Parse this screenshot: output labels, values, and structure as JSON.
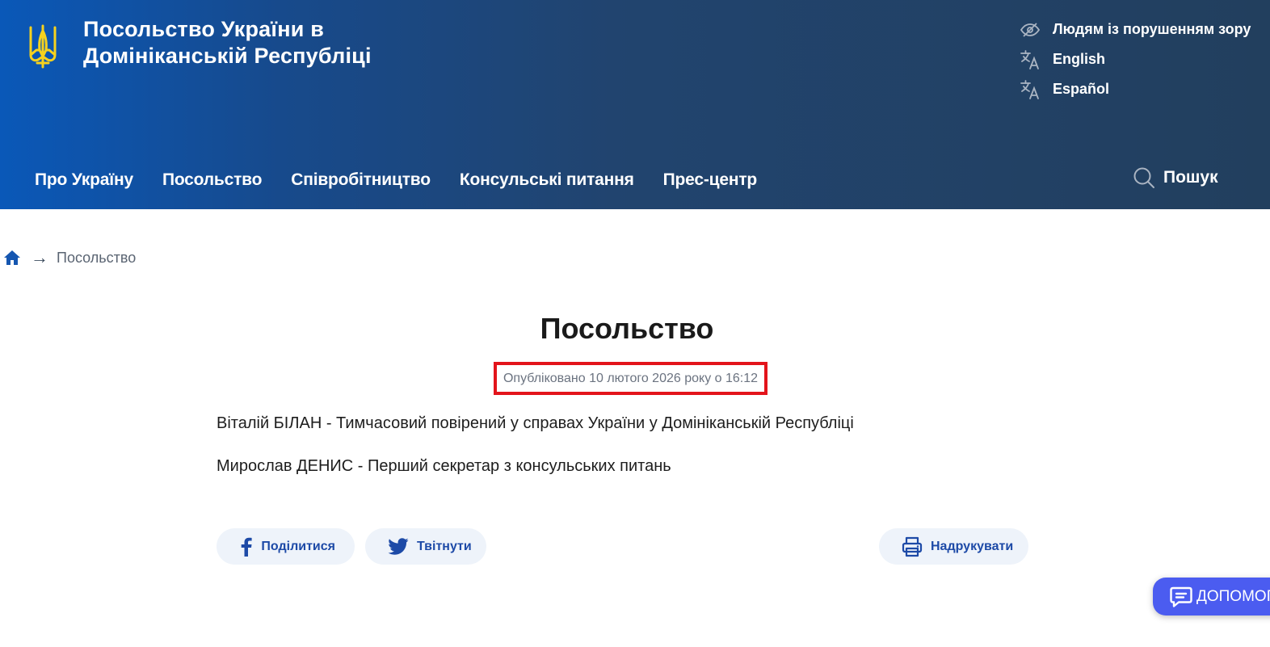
{
  "header": {
    "title_line1": "Посольство України в",
    "title_line2": "Домініканській Республіці",
    "colors": {
      "gradient_start": "#0a58b8",
      "gradient_end": "#223f5e",
      "emblem": "#f6d21e"
    },
    "utility_links": [
      {
        "label": "Людям із порушенням зору",
        "icon": "low-vision-icon"
      },
      {
        "label": "English",
        "icon": "translate-icon"
      },
      {
        "label": "Español",
        "icon": "translate-icon"
      }
    ]
  },
  "nav": {
    "items": [
      "Про Україну",
      "Посольство",
      "Співробітництво",
      "Консульські питання",
      "Прес-центр"
    ],
    "search_label": "Пошук"
  },
  "breadcrumb": {
    "home_icon": "home-icon",
    "separator": "→",
    "current": "Посольство"
  },
  "article": {
    "title": "Посольство",
    "published": "Опубліковано 10 лютого 2026 року о 16:12",
    "highlight_color": "#e3141b",
    "paragraphs": [
      "Віталій БІЛАН - Тимчасовий повірений у справах України у Домініканській Республіці",
      "Мирослав ДЕНИС - Перший секретар з консульських питань"
    ]
  },
  "share": {
    "facebook_label": "Поділитися",
    "twitter_label": "Твітнути",
    "print_label": "Надрукувати",
    "accent": "#1d4aa7"
  },
  "help_widget": {
    "label": "ДОПОМОГА",
    "color": "#4b5cf0"
  }
}
